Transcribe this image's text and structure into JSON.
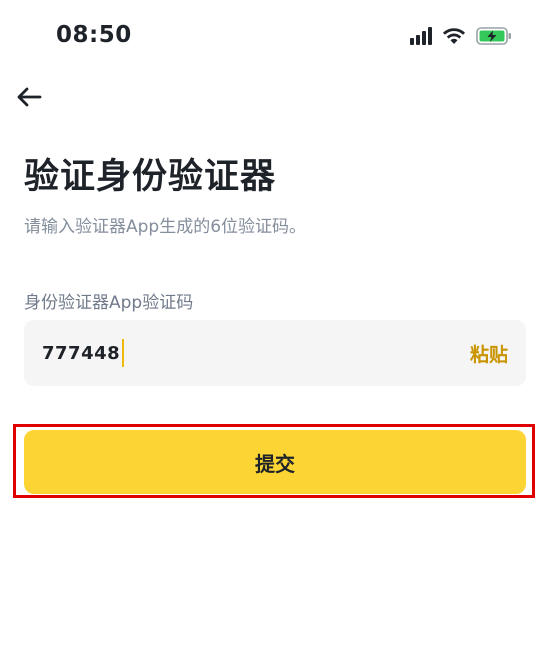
{
  "status_bar": {
    "time": "08:50",
    "icons": [
      "cellular-signal-icon",
      "wifi-icon",
      "battery-charging-icon"
    ]
  },
  "nav": {
    "back_icon": "arrow-left-icon"
  },
  "page": {
    "title": "验证身份验证器",
    "subtitle": "请输入验证器App生成的6位验证码。"
  },
  "form": {
    "label": "身份验证器App验证码",
    "code_value": "777448",
    "paste_label": "粘贴",
    "submit_label": "提交"
  },
  "colors": {
    "accent": "#fcd535",
    "paste": "#c99400",
    "highlight_outline": "#e00000"
  }
}
